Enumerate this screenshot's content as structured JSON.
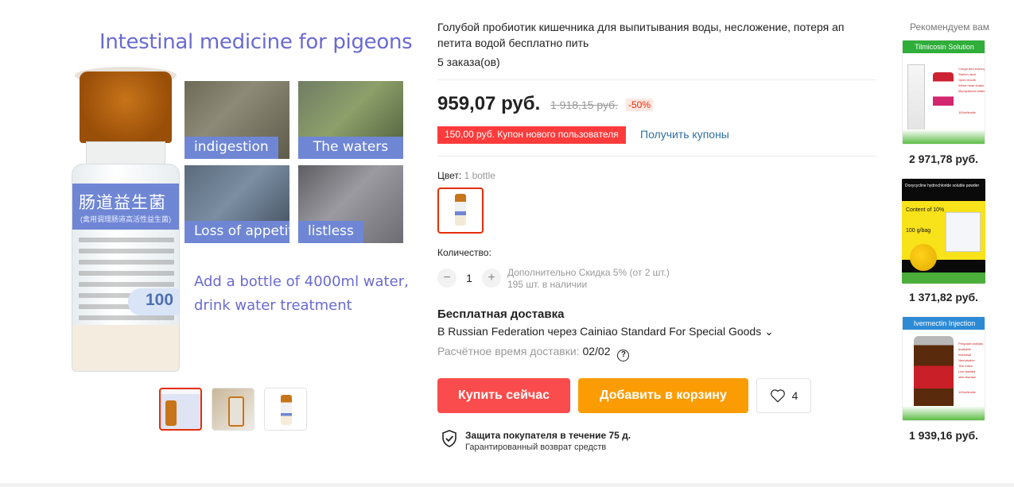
{
  "gallery": {
    "main_title": "Intestinal medicine for pigeons",
    "bottle_label_cn": "肠道益生菌",
    "bottle_label_sub": "(禽用调理肠道高活性益生菌)",
    "bottle_badge": "100",
    "photo_tags": [
      "indigestion",
      "The waters",
      "Loss of appetite",
      "listless"
    ],
    "add_text_line1": "Add a bottle of 4000ml water,",
    "add_text_line2": "drink water treatment",
    "thumbnails": [
      "thumb-1",
      "thumb-2",
      "thumb-3"
    ],
    "active_thumbnail": 0
  },
  "product": {
    "title": "Голубой пробиотик кишечника для выпитывания воды, несложение, потеря ап петита водой бесплатно пить",
    "orders": "5 заказа(ов)",
    "price": "959,07 руб.",
    "old_price": "1 918,15 руб.",
    "discount": "-50%",
    "coupon": "150,00 руб. Купон нового пользователя",
    "coupon_link": "Получить купоны",
    "color_label": "Цвет:",
    "color_value": "1 bottle",
    "quantity_label": "Количество:",
    "quantity_minus": "−",
    "quantity": "1",
    "quantity_plus": "+",
    "quantity_note_line1": "Дополнительно Скидка 5% (от 2 шт.)",
    "quantity_note_line2": "195 шт. в наличии",
    "shipping_title": "Бесплатная доставка",
    "shipping_via": "В Russian Federation через Cainiao Standard For Special Goods",
    "shipping_chevron": "⌄",
    "delivery_label": "Расчётное время доставки:",
    "delivery_value": "02/02",
    "help_icon_glyph": "?",
    "buy_now": "Купить сейчас",
    "add_to_cart": "Добавить в корзину",
    "wishlist_count": "4",
    "protection_title": "Защита покупателя в течение 75 д.",
    "protection_sub": "Гарантированный возврат средств"
  },
  "recommended": {
    "title": "Рекомендуем вам",
    "items": [
      {
        "label": "Tilmicosin Solution",
        "price": "2 971,78 руб.",
        "notes": [
          "Cough and snoring",
          "Stretch neck",
          "Open mouth",
          "Weird head shake",
          "Mycoplasma water"
        ],
        "footer": "100ml/bottle"
      },
      {
        "label": "Doxycycline hydrochloride soluble powder",
        "price": "1 371,82 руб.",
        "notes": [
          "Content of 10%",
          "100 g/bag"
        ]
      },
      {
        "label": "Ivermectin Injection",
        "price": "1 939,16 руб.",
        "notes": [
          "Pregnant animals available",
          "Intestinal",
          "Nematodes",
          "Tick mites",
          "Lice fastidid",
          "skin disease"
        ],
        "footer": "100ml/bottle"
      }
    ]
  },
  "colors": {
    "accent_red": "#fa4c4c",
    "cart_orange": "#fb9c05",
    "link_blue": "#2e6e9e",
    "gallery_purple": "#6f86d4"
  }
}
